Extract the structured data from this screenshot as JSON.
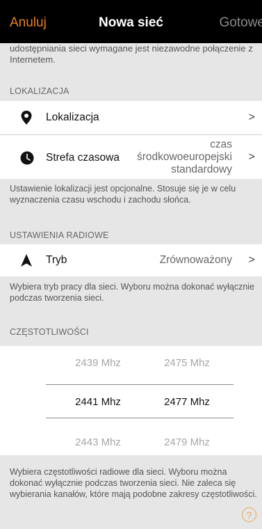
{
  "topbar": {
    "cancel_label": "Anuluj",
    "title": "Nowa sieć",
    "done_label": "Gotowe"
  },
  "intro_text": "Stwórz nową sieć i zdefiniuj jej ustawienia udostępniania. Do udostępniania sieci wymagane jest niezawodne połączenie z Internetem.",
  "location_section": {
    "header": "LOKALIZACJA",
    "location_row": {
      "label": "Lokalizacja",
      "icon": "location-pin-icon"
    },
    "timezone_row": {
      "label": "Strefa czasowa",
      "value_lines": [
        "czas",
        "środkowoeuropejski",
        "standardowy"
      ],
      "icon": "clock-icon"
    },
    "note": "Ustawienie lokalizacji jest opcjonalne. Stosuje się je w celu wyznaczenia czasu wschodu i zachodu słońca."
  },
  "radio_section": {
    "header": "USTAWIENIA RADIOWE",
    "mode_row": {
      "label": "Tryb",
      "value": "Zrównoważony",
      "icon": "navigation-arrow-icon"
    },
    "note": "Wybiera tryb pracy dla sieci. Wyboru można dokonać wyłącznie podczas tworzenia sieci."
  },
  "frequency_section": {
    "header": "CZĘSTOTLIWOŚCI",
    "column_1": [
      "2439 Mhz",
      "2441 Mhz",
      "2443 Mhz"
    ],
    "column_2": [
      "2475 Mhz",
      "2477 Mhz",
      "2479 Mhz"
    ],
    "selected_index": 1,
    "note": "Wybiera częstotliwości radiowe dla sieci. Wyboru można dokonać wyłącznie podczas tworzenia sieci. Nie zaleca się wybierania kanałów, które mają podobne zakresy częstotliwości."
  },
  "help_label": "?",
  "chevron": ">",
  "colors": {
    "accent": "#e87f1f",
    "background": "#e6e6e6",
    "done_disabled": "#8a8a8a"
  }
}
